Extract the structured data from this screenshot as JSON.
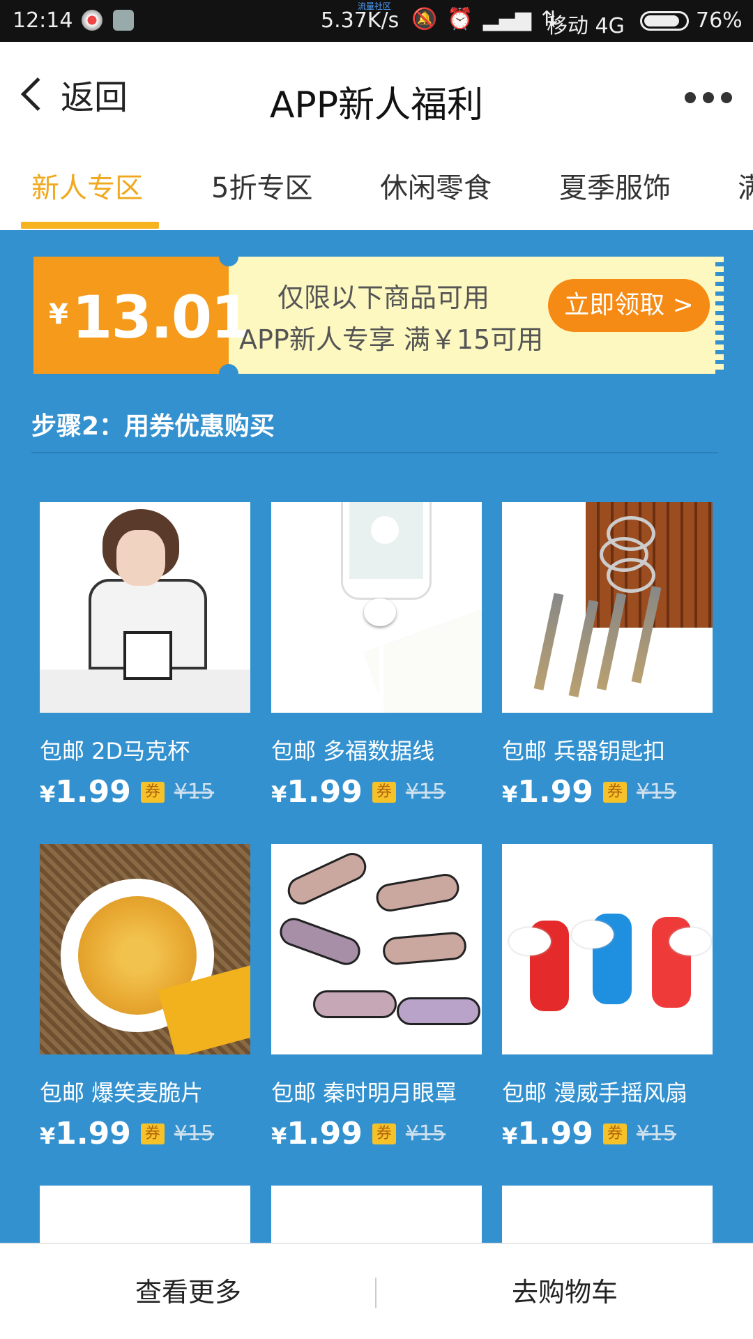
{
  "status_bar": {
    "time": "12:14",
    "network_label": "流量社区",
    "speed": "5.37K/s",
    "carrier": "移动 4G",
    "battery": "76%"
  },
  "header": {
    "back_label": "返回",
    "title": "APP新人福利"
  },
  "tabs": [
    "新人专区",
    "5折专区",
    "休闲零食",
    "夏季服饰",
    "满"
  ],
  "coupon": {
    "yen": "¥",
    "amount": "13.01",
    "line1": "仅限以下商品可用",
    "line2": "APP新人专享 满￥15可用",
    "claim_label": "立即领取 >"
  },
  "step_label": "步骤2：用券优惠购买",
  "products": [
    {
      "name": "包邮 2D马克杯",
      "price_symbol": "¥",
      "price": "1.99",
      "badge": "券",
      "original": "¥15"
    },
    {
      "name": "包邮 多福数据线",
      "price_symbol": "¥",
      "price": "1.99",
      "badge": "券",
      "original": "¥15"
    },
    {
      "name": "包邮 兵器钥匙扣",
      "price_symbol": "¥",
      "price": "1.99",
      "badge": "券",
      "original": "¥15"
    },
    {
      "name": "包邮 爆笑麦脆片",
      "price_symbol": "¥",
      "price": "1.99",
      "badge": "券",
      "original": "¥15"
    },
    {
      "name": "包邮 秦时明月眼罩",
      "price_symbol": "¥",
      "price": "1.99",
      "badge": "券",
      "original": "¥15"
    },
    {
      "name": "包邮 漫威手摇风扇",
      "price_symbol": "¥",
      "price": "1.99",
      "badge": "券",
      "original": "¥15"
    }
  ],
  "bottom": {
    "more_label": "查看更多",
    "cart_label": "去购物车"
  },
  "colors": {
    "accent": "#f6b21f",
    "background_blue": "#3391cf",
    "coupon_orange": "#f59a1a"
  }
}
